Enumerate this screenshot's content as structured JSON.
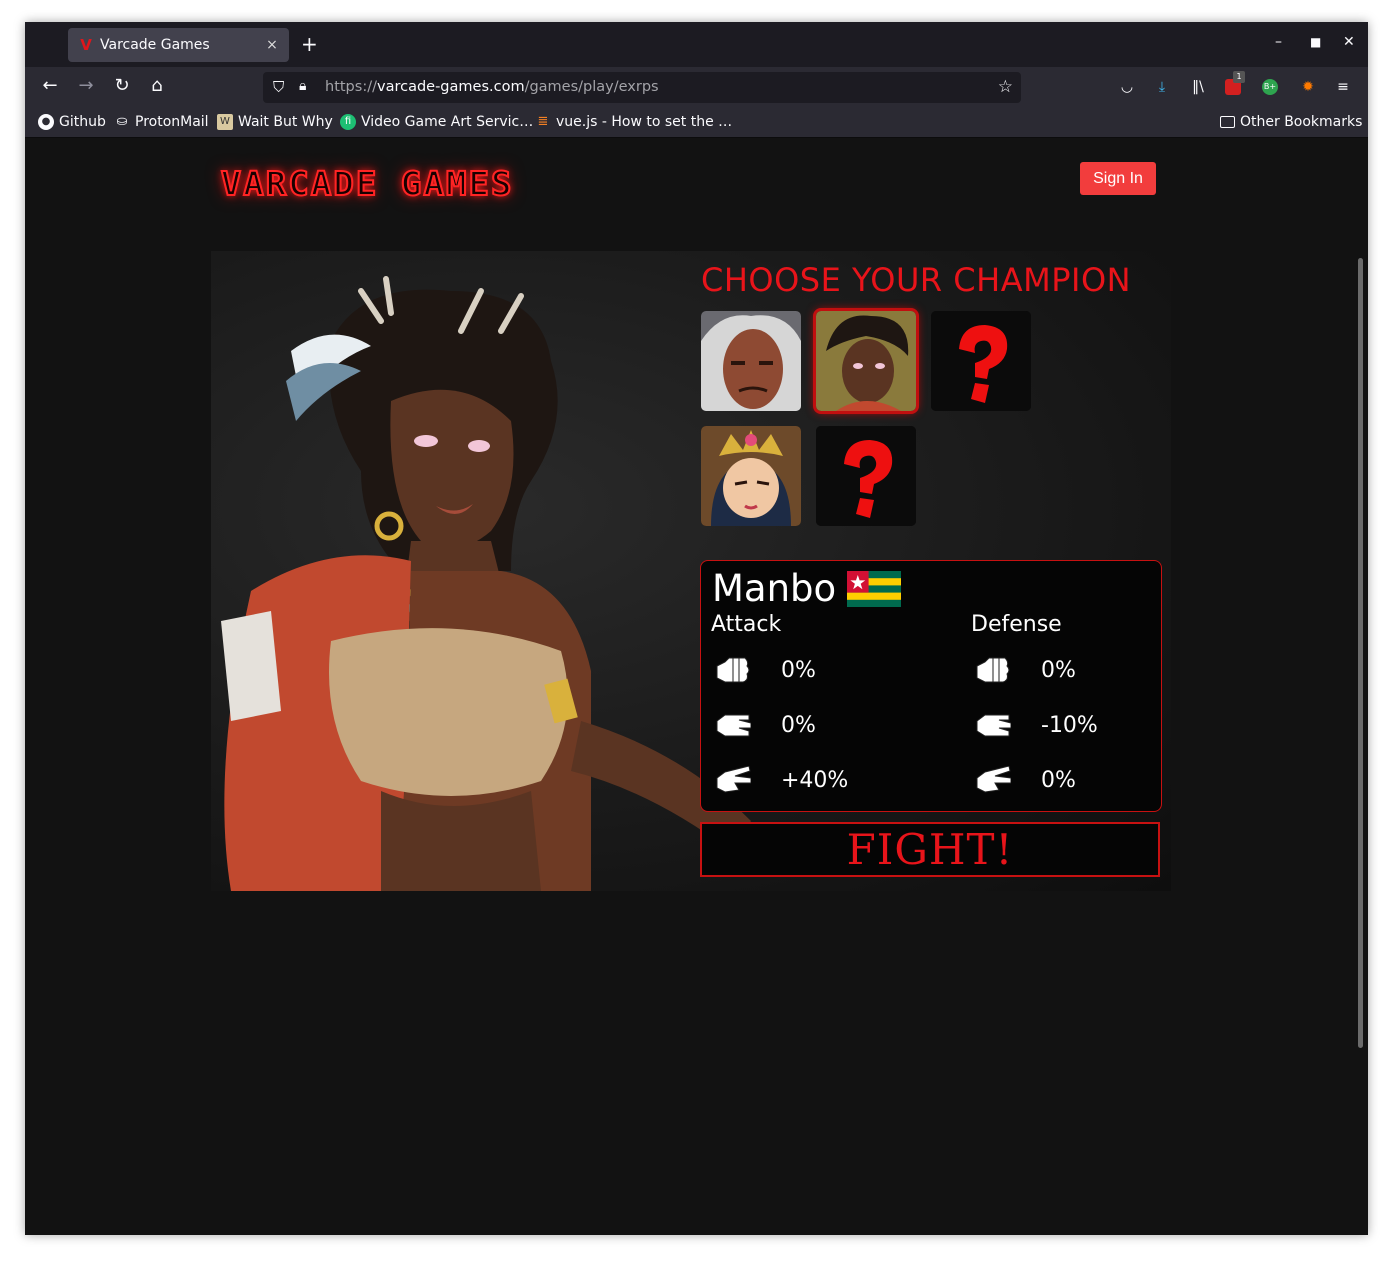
{
  "browser": {
    "tab_title": "Varcade Games",
    "tab_close": "×",
    "new_tab": "+",
    "url_scheme": "https://",
    "url_host": "varcade-games.com",
    "url_path": "/games/play/exrps",
    "extension_badge": "1",
    "bookmarks": [
      {
        "label": "Github",
        "icon": "github-icon"
      },
      {
        "label": "ProtonMail",
        "icon": "protonmail-icon"
      },
      {
        "label": "Wait But Why",
        "icon": "waitbutwhy-icon"
      },
      {
        "label": "Video Game Art Servic…",
        "icon": "fiverr-icon"
      },
      {
        "label": "vue.js - How to set the …",
        "icon": "stackoverflow-icon"
      }
    ],
    "other_bookmarks": "Other Bookmarks"
  },
  "site": {
    "logo_text": "VARCADE GAMES",
    "signin_label": "Sign In"
  },
  "game": {
    "heading": "CHOOSE YOUR CHAMPION",
    "champions": [
      {
        "id": "old-warrior",
        "state": "available"
      },
      {
        "id": "manbo",
        "state": "selected"
      },
      {
        "id": "locked-1",
        "state": "locked",
        "glyph": "?"
      },
      {
        "id": "crowned-heroine",
        "state": "available"
      },
      {
        "id": "locked-2",
        "state": "locked",
        "glyph": "?"
      }
    ],
    "selected": {
      "name": "Manbo",
      "flag": "togo-flag",
      "attack_label": "Attack",
      "defense_label": "Defense",
      "attack": {
        "rock": "0%",
        "paper": "0%",
        "scissors": "+40%"
      },
      "defense": {
        "rock": "0%",
        "paper": "-10%",
        "scissors": "0%"
      }
    },
    "fight_label": "FIGHT!"
  },
  "colors": {
    "accent_red": "#e8141a",
    "signin_bg": "#f23d3d",
    "page_bg": "#121212"
  }
}
